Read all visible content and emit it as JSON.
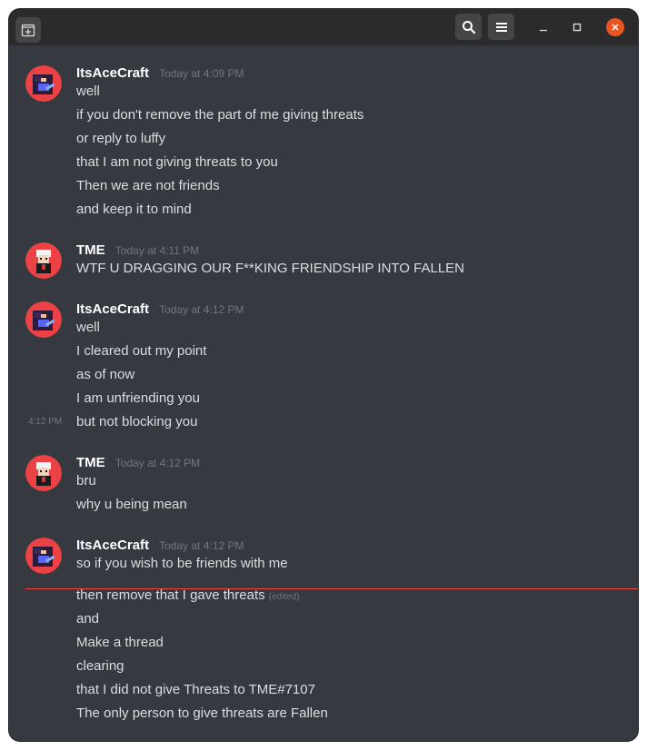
{
  "titlebar": {
    "new_tab_icon": "new-tab-icon",
    "search_icon": "search-icon",
    "menu_icon": "hamburger-menu-icon",
    "minimize_icon": "minimize-icon",
    "maximize_icon": "maximize-icon",
    "close_icon": "close-icon",
    "close_color": "#e95420"
  },
  "messages": [
    {
      "author": "ItsAceCraft",
      "timestamp": "Today at 4:09 PM",
      "lines": [
        "well",
        "if you don't remove the part of me giving threats",
        "or reply to luffy",
        "that I am not giving threats to you",
        "Then we are not friends",
        "and keep it to mind"
      ]
    },
    {
      "author": "TME",
      "timestamp": "Today at 4:11 PM",
      "lines": [
        "WTF U DRAGGING OUR F**KING FRIENDSHIP INTO FALLEN"
      ]
    },
    {
      "author": "ItsAceCraft",
      "timestamp": "Today at 4:12 PM",
      "lines": [
        "well",
        "I cleared out my point",
        "as of now",
        "I am unfriending you",
        "but not blocking you"
      ],
      "hover_time": "4:12 PM"
    },
    {
      "author": "TME",
      "timestamp": "Today at 4:12 PM",
      "lines": [
        "bru",
        "why u being mean"
      ]
    },
    {
      "author": "ItsAceCraft",
      "timestamp": "Today at 4:12 PM",
      "lines": [
        "so if you wish to be friends with me",
        "then remove that I gave threats",
        "and",
        "Make a thread",
        "clearing",
        "that I did not give Threats to TME#7107",
        "The only person to give threats are Fallen"
      ],
      "edited_label": "(edited)"
    }
  ],
  "colors": {
    "background": "#36393f",
    "author": "#ffffff",
    "text": "#dcddde",
    "muted": "#72767d",
    "new_messages_divider": "#f04747",
    "avatar_bg": "#ed4245"
  }
}
